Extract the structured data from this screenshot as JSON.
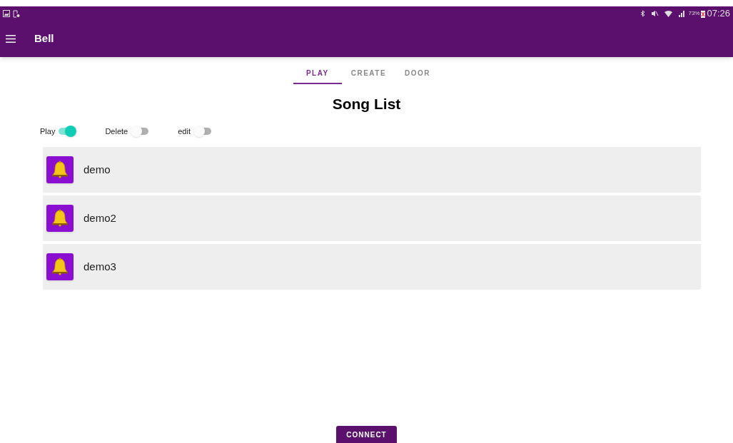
{
  "status_bar": {
    "battery": "73%",
    "time": "07:26"
  },
  "app_bar": {
    "title": "Bell"
  },
  "tabs": [
    {
      "label": "PLAY",
      "selected": true
    },
    {
      "label": "CREATE",
      "selected": false
    },
    {
      "label": "DOOR",
      "selected": false
    }
  ],
  "heading": "Song List",
  "switches": [
    {
      "label": "Play",
      "on": true
    },
    {
      "label": "Delete",
      "on": false
    },
    {
      "label": "edit",
      "on": false
    }
  ],
  "songs": [
    {
      "name": "demo"
    },
    {
      "name": "demo2"
    },
    {
      "name": "demo3"
    }
  ],
  "connect_button": "CONNECT"
}
